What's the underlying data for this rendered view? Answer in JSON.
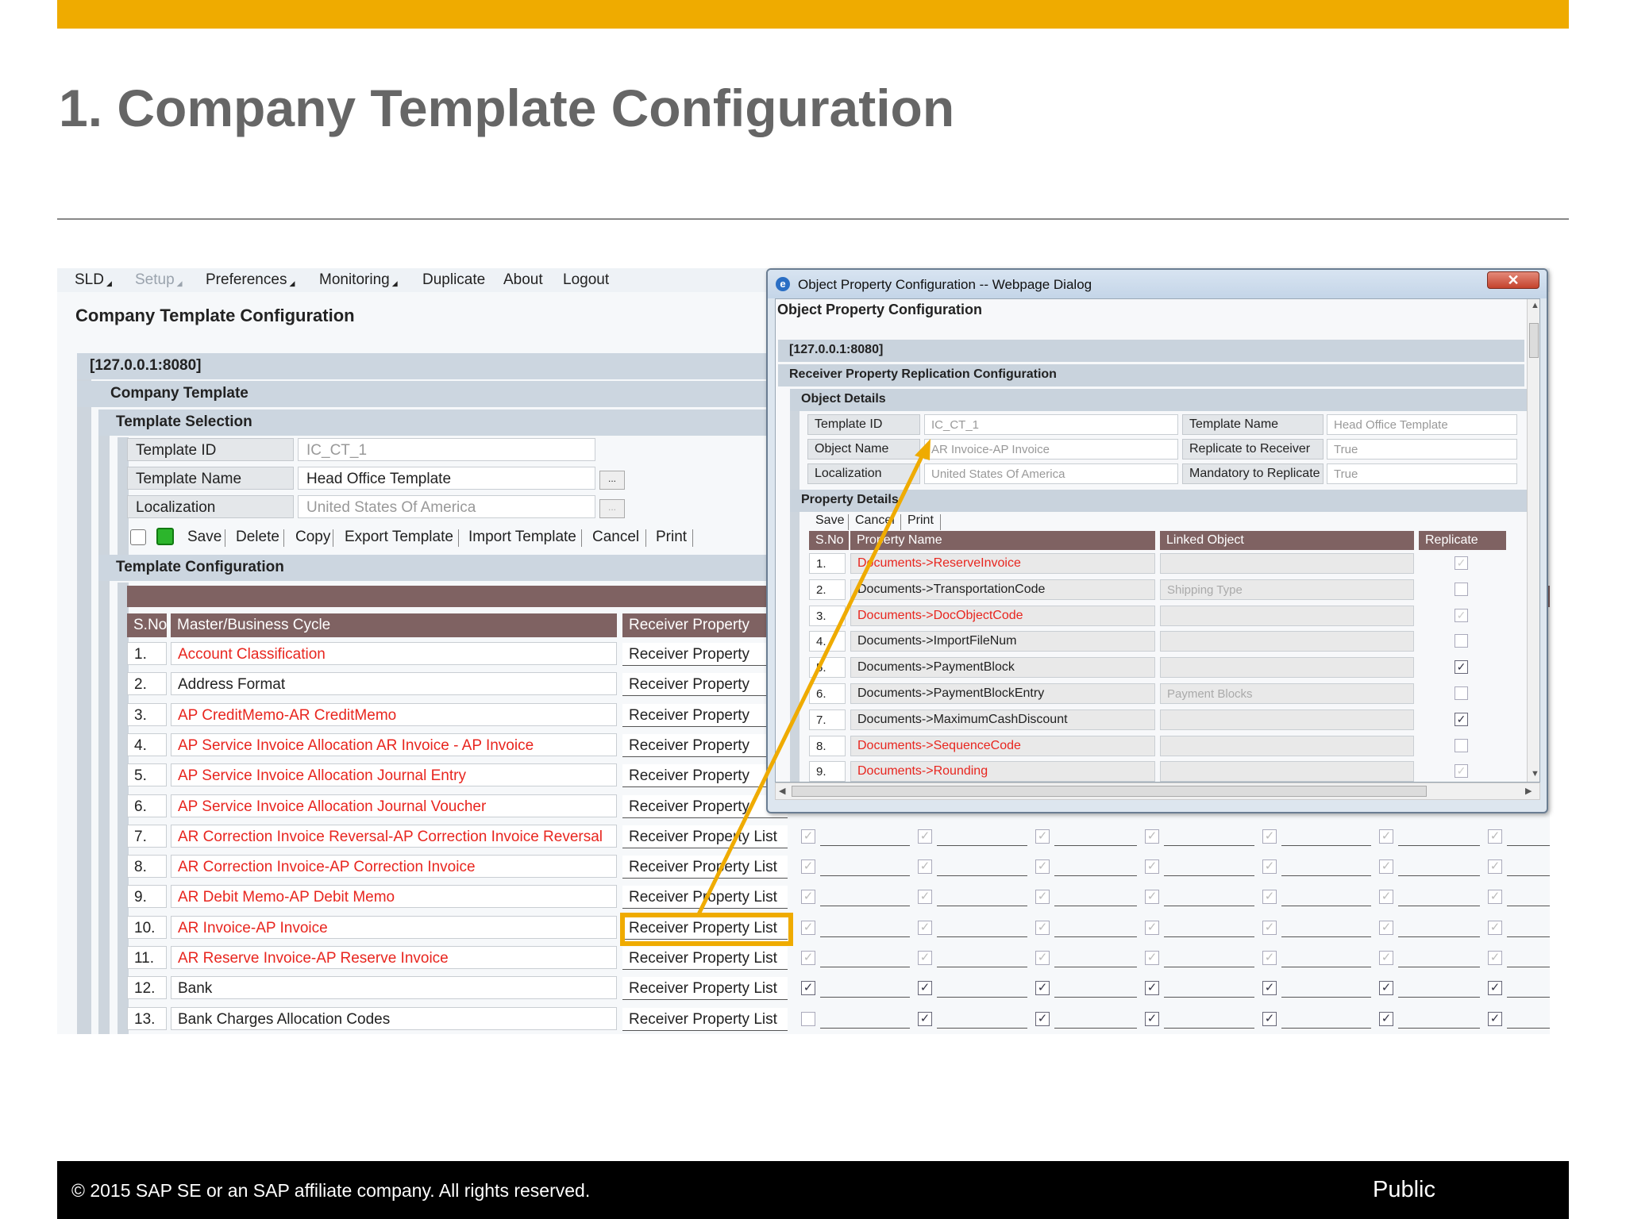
{
  "slide": {
    "title": "1. Company Template Configuration",
    "footer_copy": "©  2015 SAP SE or an SAP affiliate company. All rights reserved.",
    "footer_label": "Public",
    "accent_color": "#efab00"
  },
  "app": {
    "menu": [
      "SLD",
      "Setup",
      "Preferences",
      "Monitoring",
      "Duplicate",
      "About",
      "Logout"
    ],
    "heading": "Company Template Configuration",
    "server": "[127.0.0.1:8080]",
    "section_company": "Company Template",
    "section_selection": "Template Selection",
    "fields": {
      "template_id_label": "Template ID",
      "template_id_value": "IC_CT_1",
      "template_name_label": "Template Name",
      "template_name_value": "Head Office Template",
      "localization_label": "Localization",
      "localization_value": "United States Of America",
      "lookup_button": "..."
    },
    "toolbar": [
      "Save",
      "Delete",
      "Copy",
      "Export Template",
      "Import Template",
      "Cancel",
      "Print"
    ],
    "section_config": "Template Configuration",
    "grid_headers": {
      "no": "S.No",
      "name": "Master/Business Cycle",
      "recv": "Receiver Property"
    },
    "rows": [
      {
        "no": "1.",
        "name": "Account Classification",
        "recv": "Receiver Property",
        "red": true
      },
      {
        "no": "2.",
        "name": "Address Format",
        "recv": "Receiver Property",
        "red": false
      },
      {
        "no": "3.",
        "name": "AP CreditMemo-AR CreditMemo",
        "recv": "Receiver Property",
        "red": true
      },
      {
        "no": "4.",
        "name": "AP Service Invoice Allocation AR Invoice - AP Invoice",
        "recv": "Receiver Property",
        "red": true
      },
      {
        "no": "5.",
        "name": "AP Service Invoice Allocation Journal Entry",
        "recv": "Receiver Property",
        "red": true
      },
      {
        "no": "6.",
        "name": "AP Service Invoice Allocation Journal Voucher",
        "recv": "Receiver Property",
        "red": true
      },
      {
        "no": "7.",
        "name": "AR Correction Invoice Reversal-AP Correction Invoice Reversal",
        "recv": "Receiver Property List",
        "red": true
      },
      {
        "no": "8.",
        "name": "AR Correction Invoice-AP Correction Invoice",
        "recv": "Receiver Property List",
        "red": true
      },
      {
        "no": "9.",
        "name": "AR Debit Memo-AP Debit Memo",
        "recv": "Receiver Property List",
        "red": true
      },
      {
        "no": "10.",
        "name": "AR Invoice-AP Invoice",
        "recv": "Receiver Property List",
        "red": true
      },
      {
        "no": "11.",
        "name": "AR Reserve Invoice-AP Reserve Invoice",
        "recv": "Receiver Property List",
        "red": true
      },
      {
        "no": "12.",
        "name": "Bank",
        "recv": "Receiver Property List",
        "red": false
      },
      {
        "no": "13.",
        "name": "Bank Charges Allocation Codes",
        "recv": "Receiver Property List",
        "red": false
      }
    ],
    "check_rows": [
      [
        true,
        true,
        true,
        true,
        true,
        true,
        true
      ],
      [
        true,
        true,
        true,
        true,
        true,
        true,
        true
      ],
      [
        true,
        true,
        true,
        true,
        true,
        true,
        true
      ],
      [
        true,
        true,
        true,
        true,
        true,
        true,
        true
      ],
      [
        true,
        true,
        true,
        true,
        true,
        true,
        true
      ],
      [
        true,
        true,
        true,
        true,
        true,
        true,
        true
      ],
      [
        false,
        true,
        true,
        true,
        true,
        true,
        true
      ]
    ],
    "check_rows_enabled": [
      false,
      false,
      false,
      false,
      false,
      true,
      true
    ]
  },
  "dialog": {
    "title": "Object Property Configuration -- Webpage Dialog",
    "close_glyph": "✕",
    "heading": "Object Property Configuration",
    "server": "[127.0.0.1:8080]",
    "section_replication": "Receiver Property Replication Configuration",
    "section_object": "Object Details",
    "object_fields": {
      "template_id_label": "Template ID",
      "template_id_value": "IC_CT_1",
      "template_name_label": "Template Name",
      "template_name_value": "Head Office Template",
      "object_name_label": "Object Name",
      "object_name_value": "AR Invoice-AP Invoice",
      "replicate_label": "Replicate to Receiver",
      "replicate_value": "True",
      "localization_label": "Localization",
      "localization_value": "United States Of America",
      "mandatory_label": "Mandatory to Replicate",
      "mandatory_value": "True"
    },
    "section_property": "Property Details",
    "toolbar": [
      "Save",
      "Cancel",
      "Print"
    ],
    "grid_headers": {
      "no": "S.No",
      "name": "Property Name",
      "linked": "Linked Object",
      "replicate": "Replicate"
    },
    "rows": [
      {
        "no": "1.",
        "name": "Documents->ReserveInvoice",
        "linked": "",
        "red": true,
        "checked": true,
        "enabled": false
      },
      {
        "no": "2.",
        "name": "Documents->TransportationCode",
        "linked": "Shipping Type",
        "red": false,
        "checked": false,
        "enabled": true
      },
      {
        "no": "3.",
        "name": "Documents->DocObjectCode",
        "linked": "",
        "red": true,
        "checked": true,
        "enabled": false
      },
      {
        "no": "4.",
        "name": "Documents->ImportFileNum",
        "linked": "",
        "red": false,
        "checked": false,
        "enabled": true
      },
      {
        "no": "5.",
        "name": "Documents->PaymentBlock",
        "linked": "",
        "red": false,
        "checked": true,
        "enabled": true
      },
      {
        "no": "6.",
        "name": "Documents->PaymentBlockEntry",
        "linked": "Payment Blocks",
        "red": false,
        "checked": false,
        "enabled": true
      },
      {
        "no": "7.",
        "name": "Documents->MaximumCashDiscount",
        "linked": "",
        "red": false,
        "checked": true,
        "enabled": true
      },
      {
        "no": "8.",
        "name": "Documents->SequenceCode",
        "linked": "",
        "red": true,
        "checked": false,
        "enabled": false
      },
      {
        "no": "9.",
        "name": "Documents->Rounding",
        "linked": "",
        "red": true,
        "checked": true,
        "enabled": false
      }
    ]
  }
}
